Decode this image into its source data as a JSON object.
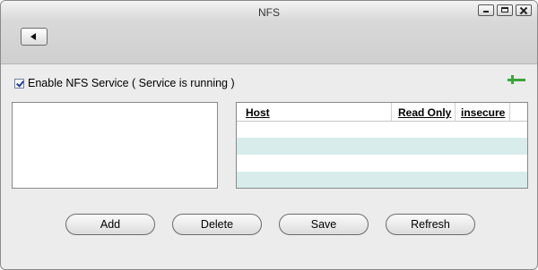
{
  "window": {
    "title": "NFS"
  },
  "controls": {
    "minimize": "minimize-icon",
    "maximize": "maximize-icon",
    "close": "close-icon"
  },
  "toolbar": {
    "back_icon": "back-arrow-icon"
  },
  "service": {
    "checked": true,
    "label": "Enable NFS Service ( Service is running )"
  },
  "share_actions": {
    "add_icon": "plus-icon",
    "remove_icon": "minus-icon"
  },
  "hosts_table": {
    "columns": [
      "Host",
      "Read Only",
      "insecure"
    ],
    "rows": []
  },
  "buttons": {
    "add": "Add",
    "delete": "Delete",
    "save": "Save",
    "refresh": "Refresh"
  }
}
